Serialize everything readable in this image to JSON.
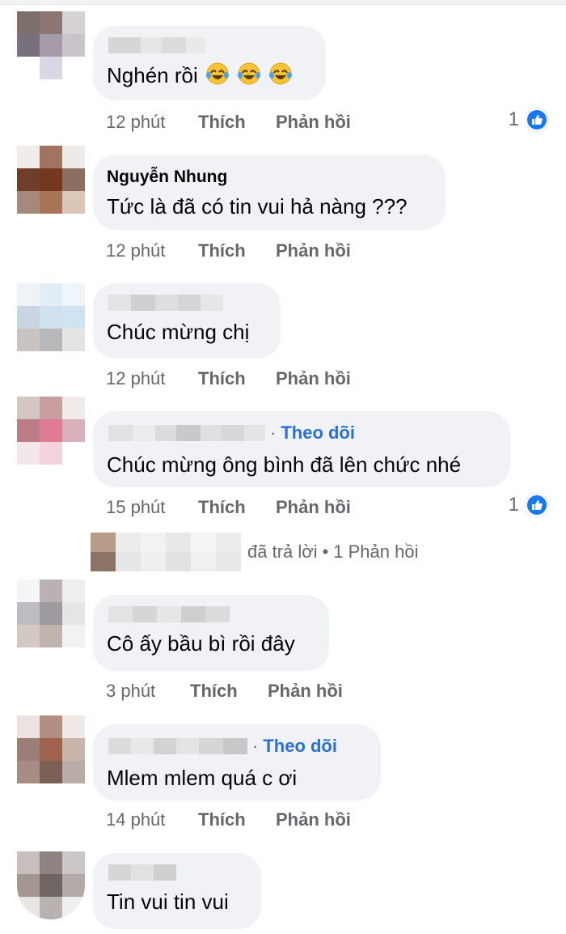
{
  "comments": [
    {
      "name": "",
      "text": "Nghén rồi",
      "time": "12 phút",
      "like": "Thích",
      "reply": "Phản hồi",
      "reaction_count": "1",
      "follow": "",
      "emojis": [
        "laughing-tears",
        "laughing-tears",
        "laughing-tears"
      ]
    },
    {
      "name": "Nguyễn Nhung",
      "text": "Tức là đã có tin vui hả nàng ???",
      "time": "12 phút",
      "like": "Thích",
      "reply": "Phản hồi",
      "reaction_count": "",
      "follow": ""
    },
    {
      "name": "",
      "text": "Chúc mừng chị",
      "time": "12 phút",
      "like": "Thích",
      "reply": "Phản hồi",
      "reaction_count": "",
      "follow": ""
    },
    {
      "name": "",
      "text": "Chúc mừng ông bình đã lên chức nhé",
      "time": "15 phút",
      "like": "Thích",
      "reply": "Phản hồi",
      "reaction_count": "1",
      "follow": "Theo dõi"
    },
    {
      "name": "",
      "text": "Cô ấy bầu bì rồi đây",
      "time": "3 phút",
      "like": "Thích",
      "reply": "Phản hồi",
      "reaction_count": "",
      "follow": ""
    },
    {
      "name": "",
      "text": "Mlem mlem quá c ơi",
      "time": "14 phút",
      "like": "Thích",
      "reply": "Phản hồi",
      "reaction_count": "",
      "follow": "Theo dõi"
    },
    {
      "name": "",
      "text": "Tin vui tin vui",
      "time": "",
      "like": "",
      "reply": "",
      "reaction_count": "",
      "follow": ""
    }
  ],
  "replies_summary": {
    "text": "đã trả lời",
    "count": "1 Phản hồi"
  },
  "colors": {
    "bubble": "#f0f2f5",
    "link": "#2a6fd6",
    "meta": "#65676b",
    "like_icon": "#1877f2"
  },
  "icons": {
    "reaction": "thumbs-up-icon",
    "emoji": "laughing-tears-emoji"
  }
}
